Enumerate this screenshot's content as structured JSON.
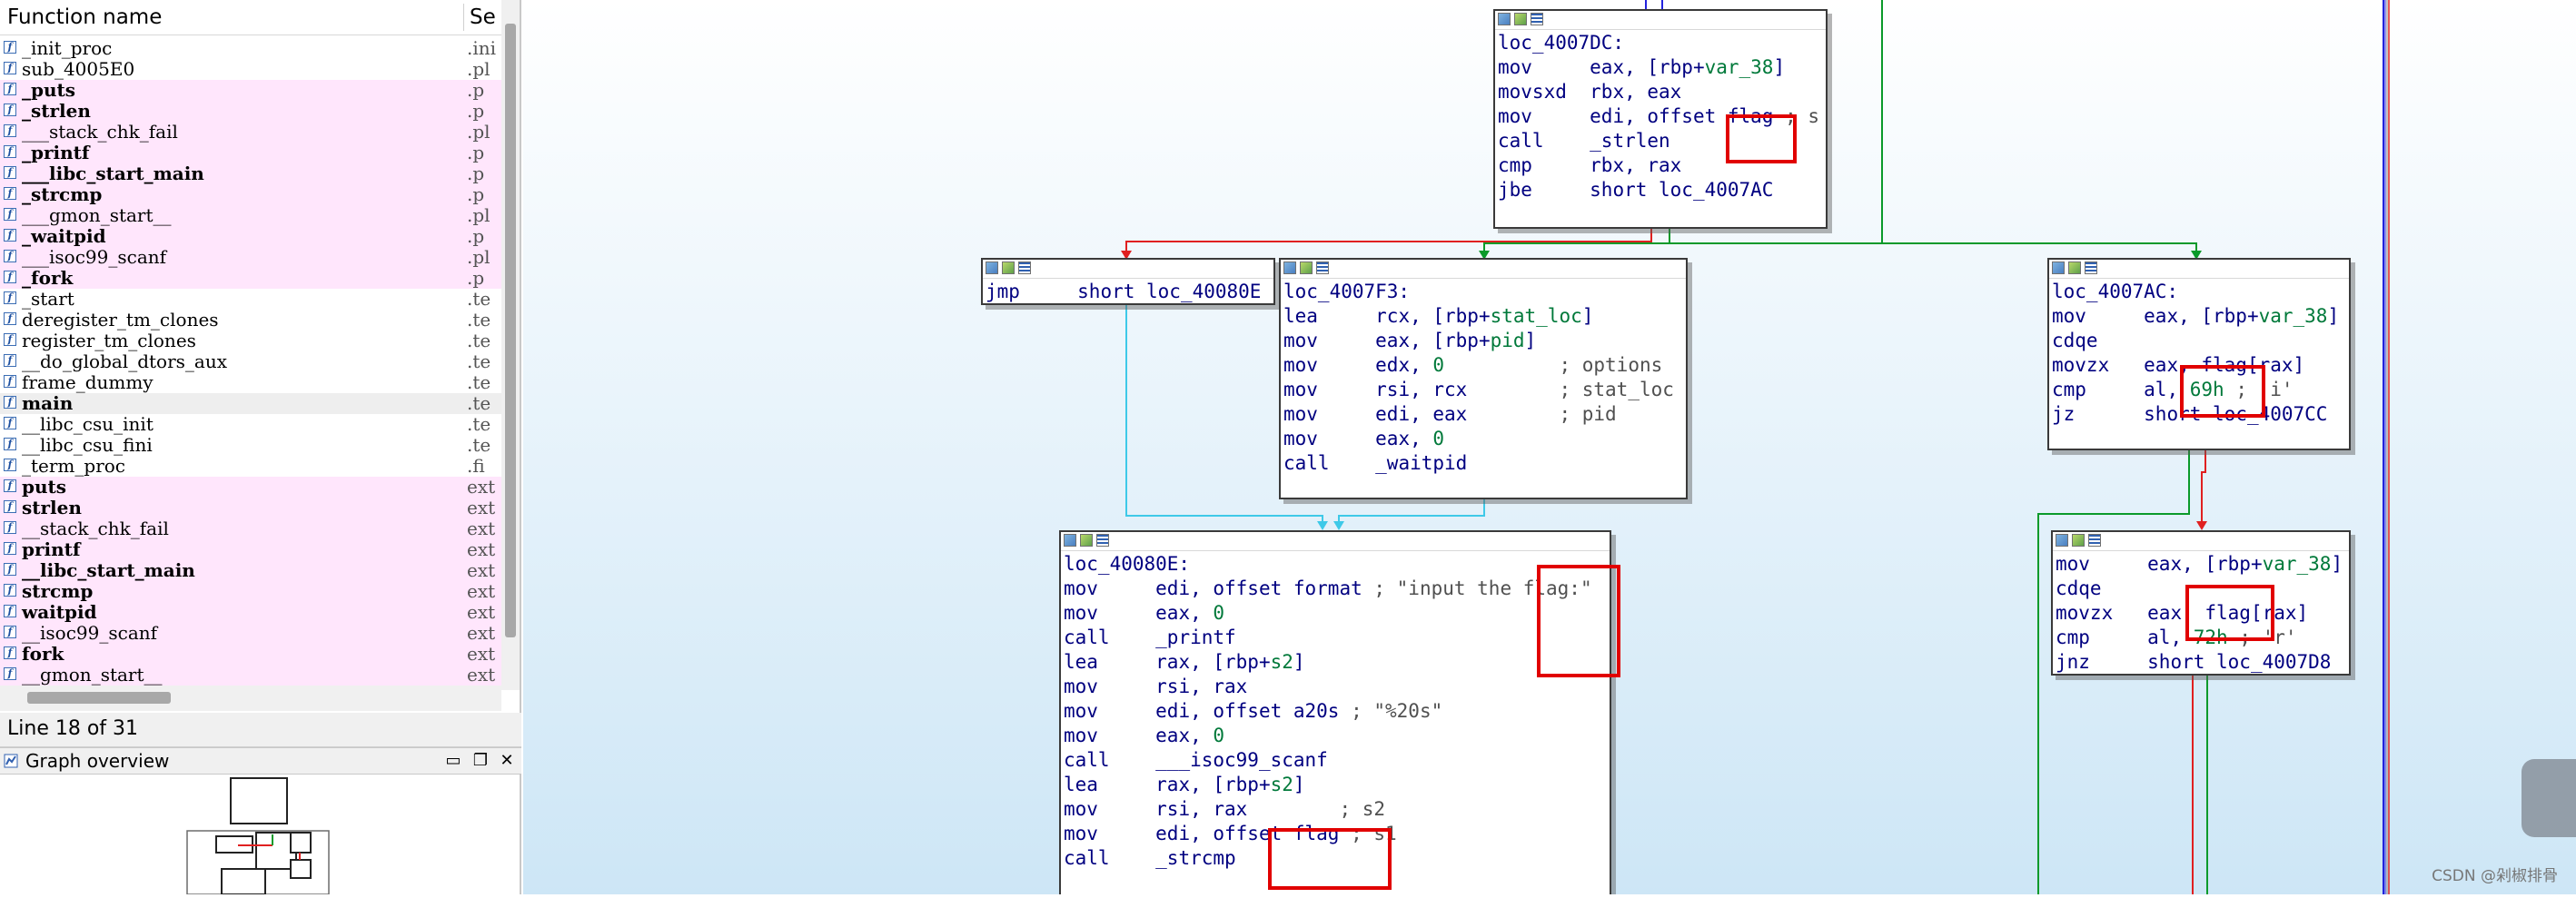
{
  "function_list": {
    "header": {
      "name": "Function name",
      "segment": "Se"
    },
    "rows": [
      {
        "name": "_init_proc",
        "seg": ".ini",
        "style": "normal"
      },
      {
        "name": "sub_4005E0",
        "seg": ".pl",
        "style": "normal"
      },
      {
        "name": "_puts",
        "seg": ".p",
        "style": "pink-bold"
      },
      {
        "name": "_strlen",
        "seg": ".p",
        "style": "pink-bold"
      },
      {
        "name": "___stack_chk_fail",
        "seg": ".pl",
        "style": "pink"
      },
      {
        "name": "_printf",
        "seg": ".p",
        "style": "pink-bold"
      },
      {
        "name": "___libc_start_main",
        "seg": ".p",
        "style": "pink-bold"
      },
      {
        "name": "_strcmp",
        "seg": ".p",
        "style": "pink-bold"
      },
      {
        "name": "___gmon_start__",
        "seg": ".pl",
        "style": "pink"
      },
      {
        "name": "_waitpid",
        "seg": ".p",
        "style": "pink-bold"
      },
      {
        "name": "___isoc99_scanf",
        "seg": ".pl",
        "style": "pink"
      },
      {
        "name": "_fork",
        "seg": ".p",
        "style": "pink-bold"
      },
      {
        "name": "_start",
        "seg": ".te",
        "style": "normal"
      },
      {
        "name": "deregister_tm_clones",
        "seg": ".te",
        "style": "normal"
      },
      {
        "name": "register_tm_clones",
        "seg": ".te",
        "style": "normal"
      },
      {
        "name": "__do_global_dtors_aux",
        "seg": ".te",
        "style": "normal"
      },
      {
        "name": "frame_dummy",
        "seg": ".te",
        "style": "normal"
      },
      {
        "name": "main",
        "seg": ".te",
        "style": "selected-bold"
      },
      {
        "name": "__libc_csu_init",
        "seg": ".te",
        "style": "normal"
      },
      {
        "name": "__libc_csu_fini",
        "seg": ".te",
        "style": "normal"
      },
      {
        "name": "_term_proc",
        "seg": ".fi",
        "style": "normal"
      },
      {
        "name": "puts",
        "seg": "ext",
        "style": "pink-bold"
      },
      {
        "name": "strlen",
        "seg": "ext",
        "style": "pink-bold"
      },
      {
        "name": "__stack_chk_fail",
        "seg": "ext",
        "style": "pink"
      },
      {
        "name": "printf",
        "seg": "ext",
        "style": "pink-bold"
      },
      {
        "name": "__libc_start_main",
        "seg": "ext",
        "style": "pink-bold"
      },
      {
        "name": "strcmp",
        "seg": "ext",
        "style": "pink-bold"
      },
      {
        "name": "waitpid",
        "seg": "ext",
        "style": "pink-bold"
      },
      {
        "name": "__isoc99_scanf",
        "seg": "ext",
        "style": "pink"
      },
      {
        "name": "fork",
        "seg": "ext",
        "style": "pink-bold"
      },
      {
        "name": "__gmon_start__",
        "seg": "ext",
        "style": "pink"
      }
    ]
  },
  "status": {
    "text": "Line 18 of 31"
  },
  "overview": {
    "title": "Graph overview",
    "buttons": {
      "minimize": "▭",
      "restore": "❐",
      "close": "✕"
    }
  },
  "graph": {
    "nodes": [
      {
        "id": "loc_4007DC",
        "lines": [
          [
            [
              "lbl",
              "loc_4007DC:"
            ]
          ],
          [
            [
              "mn",
              "mov     "
            ],
            [
              "op",
              "eax, [rbp+"
            ],
            [
              "vr",
              "var_38"
            ],
            [
              "op",
              "]"
            ]
          ],
          [
            [
              "mn",
              "movsxd  "
            ],
            [
              "op",
              "rbx, eax"
            ]
          ],
          [
            [
              "mn",
              "mov     "
            ],
            [
              "op",
              "edi, offset "
            ],
            [
              "op",
              "flag"
            ],
            [
              "cm",
              " ; s"
            ]
          ],
          [
            [
              "mn",
              "call    "
            ],
            [
              "op",
              "_strlen"
            ]
          ],
          [
            [
              "mn",
              "cmp     "
            ],
            [
              "op",
              "rbx, rax"
            ]
          ],
          [
            [
              "mn",
              "jbe     "
            ],
            [
              "op",
              "short loc_4007AC"
            ]
          ]
        ]
      },
      {
        "id": "jmp_block",
        "lines": [
          [
            [
              "mn",
              "jmp     "
            ],
            [
              "op",
              "short loc_40080E"
            ]
          ]
        ]
      },
      {
        "id": "loc_4007F3",
        "lines": [
          [
            [
              "lbl",
              "loc_4007F3:"
            ]
          ],
          [
            [
              "mn",
              "lea     "
            ],
            [
              "op",
              "rcx, [rbp+"
            ],
            [
              "vr",
              "stat_loc"
            ],
            [
              "op",
              "]"
            ]
          ],
          [
            [
              "mn",
              "mov     "
            ],
            [
              "op",
              "eax, [rbp+"
            ],
            [
              "vr",
              "pid"
            ],
            [
              "op",
              "]"
            ]
          ],
          [
            [
              "mn",
              "mov     "
            ],
            [
              "op",
              "edx, "
            ],
            [
              "nm",
              "0"
            ],
            [
              "cm",
              "          ; options"
            ]
          ],
          [
            [
              "mn",
              "mov     "
            ],
            [
              "op",
              "rsi, rcx"
            ],
            [
              "cm",
              "        ; stat_loc"
            ]
          ],
          [
            [
              "mn",
              "mov     "
            ],
            [
              "op",
              "edi, eax"
            ],
            [
              "cm",
              "        ; pid"
            ]
          ],
          [
            [
              "mn",
              "mov     "
            ],
            [
              "op",
              "eax, "
            ],
            [
              "nm",
              "0"
            ]
          ],
          [
            [
              "mn",
              "call    "
            ],
            [
              "op",
              "_waitpid"
            ]
          ]
        ]
      },
      {
        "id": "loc_4007AC",
        "lines": [
          [
            [
              "lbl",
              "loc_4007AC:"
            ]
          ],
          [
            [
              "mn",
              "mov     "
            ],
            [
              "op",
              "eax, [rbp+"
            ],
            [
              "vr",
              "var_38"
            ],
            [
              "op",
              "]"
            ]
          ],
          [
            [
              "mn",
              "cdqe"
            ]
          ],
          [
            [
              "mn",
              "movzx   "
            ],
            [
              "op",
              "eax, flag[rax]"
            ]
          ],
          [
            [
              "mn",
              "cmp     "
            ],
            [
              "op",
              "al, "
            ],
            [
              "nm",
              "69h"
            ],
            [
              "cm",
              " ; 'i'"
            ]
          ],
          [
            [
              "mn",
              "jz      "
            ],
            [
              "op",
              "short loc_4007CC"
            ]
          ]
        ]
      },
      {
        "id": "block_72h",
        "lines": [
          [
            [
              "mn",
              "mov     "
            ],
            [
              "op",
              "eax, [rbp+"
            ],
            [
              "vr",
              "var_38"
            ],
            [
              "op",
              "]"
            ]
          ],
          [
            [
              "mn",
              "cdqe"
            ]
          ],
          [
            [
              "mn",
              "movzx   "
            ],
            [
              "op",
              "eax, flag[rax]"
            ]
          ],
          [
            [
              "mn",
              "cmp     "
            ],
            [
              "op",
              "al, "
            ],
            [
              "nm",
              "72h"
            ],
            [
              "cm",
              " ; 'r'"
            ]
          ],
          [
            [
              "mn",
              "jnz     "
            ],
            [
              "op",
              "short loc_4007D8"
            ]
          ]
        ]
      },
      {
        "id": "loc_40080E",
        "lines": [
          [
            [
              "lbl",
              "loc_40080E:"
            ]
          ],
          [
            [
              "mn",
              "mov     "
            ],
            [
              "op",
              "edi, offset format"
            ],
            [
              "cm",
              " ; \"input the flag:\""
            ]
          ],
          [
            [
              "mn",
              "mov     "
            ],
            [
              "op",
              "eax, "
            ],
            [
              "nm",
              "0"
            ]
          ],
          [
            [
              "mn",
              "call    "
            ],
            [
              "op",
              "_printf"
            ]
          ],
          [
            [
              "mn",
              "lea     "
            ],
            [
              "op",
              "rax, [rbp+"
            ],
            [
              "vr",
              "s2"
            ],
            [
              "op",
              "]"
            ]
          ],
          [
            [
              "mn",
              "mov     "
            ],
            [
              "op",
              "rsi, rax"
            ]
          ],
          [
            [
              "mn",
              "mov     "
            ],
            [
              "op",
              "edi, offset a20s"
            ],
            [
              "cm",
              " ; \"%20s\""
            ]
          ],
          [
            [
              "mn",
              "mov     "
            ],
            [
              "op",
              "eax, "
            ],
            [
              "nm",
              "0"
            ]
          ],
          [
            [
              "mn",
              "call    "
            ],
            [
              "op",
              "___isoc99_scanf"
            ]
          ],
          [
            [
              "mn",
              "lea     "
            ],
            [
              "op",
              "rax, [rbp+"
            ],
            [
              "vr",
              "s2"
            ],
            [
              "op",
              "]"
            ]
          ],
          [
            [
              "mn",
              "mov     "
            ],
            [
              "op",
              "rsi, rax"
            ],
            [
              "cm",
              "        ; s2"
            ]
          ],
          [
            [
              "mn",
              "mov     "
            ],
            [
              "op",
              "edi, offset flag"
            ],
            [
              "cm",
              " ; s1"
            ]
          ],
          [
            [
              "mn",
              "call    "
            ],
            [
              "op",
              "_strcmp"
            ]
          ]
        ]
      }
    ],
    "edge_colors": {
      "true": "#0a9a2a",
      "false": "#e02020",
      "uncond": "#3ec9e8",
      "back": "#2222dd"
    }
  },
  "watermark": "CSDN @剁椒排骨"
}
